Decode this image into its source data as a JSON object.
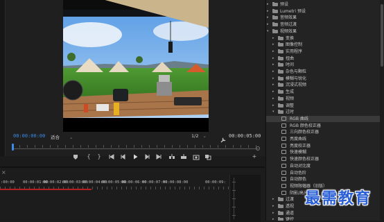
{
  "monitor": {
    "timecode_current": "00:00:00:00",
    "fit_label": "适合",
    "resolution_label": "1/2",
    "timecode_duration": "00:00:05:00"
  },
  "timeline": {
    "ruler_labels": [
      ":00:00",
      "00:00:01:00",
      "00:00:02:00",
      "00:00:03:00",
      "00:00:04:00",
      "00:00:05:00",
      "00:00:06:00",
      "00:00:07:00",
      "00:00:08:00",
      "00:00:09:"
    ]
  },
  "effects": {
    "rows": [
      {
        "label": "预设",
        "type": "folder",
        "level": 0,
        "expanded": false
      },
      {
        "label": "Lumetri 预设",
        "type": "folder",
        "level": 0,
        "expanded": false
      },
      {
        "label": "音频效果",
        "type": "folder",
        "level": 0,
        "expanded": false
      },
      {
        "label": "音频过渡",
        "type": "folder",
        "level": 0,
        "expanded": false
      },
      {
        "label": "视频效果",
        "type": "folder",
        "level": 0,
        "expanded": true
      },
      {
        "label": "变换",
        "type": "folder",
        "level": 1,
        "expanded": false
      },
      {
        "label": "图像控制",
        "type": "folder",
        "level": 1,
        "expanded": false
      },
      {
        "label": "实用程序",
        "type": "folder",
        "level": 1,
        "expanded": false
      },
      {
        "label": "扭曲",
        "type": "folder",
        "level": 1,
        "expanded": false
      },
      {
        "label": "时间",
        "type": "folder",
        "level": 1,
        "expanded": false
      },
      {
        "label": "杂色与颗粒",
        "type": "folder",
        "level": 1,
        "expanded": false
      },
      {
        "label": "模糊与锐化",
        "type": "folder",
        "level": 1,
        "expanded": false
      },
      {
        "label": "沉浸式视频",
        "type": "folder",
        "level": 1,
        "expanded": false
      },
      {
        "label": "生成",
        "type": "folder",
        "level": 1,
        "expanded": false
      },
      {
        "label": "视频",
        "type": "folder",
        "level": 1,
        "expanded": false
      },
      {
        "label": "调整",
        "type": "folder",
        "level": 1,
        "expanded": false
      },
      {
        "label": "过时",
        "type": "folder",
        "level": 1,
        "expanded": true
      },
      {
        "label": "RGB 曲线",
        "type": "effect",
        "level": 2,
        "selected": true
      },
      {
        "label": "RGB 颜色校正器",
        "type": "effect",
        "level": 2
      },
      {
        "label": "三向颜色校正器",
        "type": "effect",
        "level": 2
      },
      {
        "label": "亮度曲线",
        "type": "effect",
        "level": 2
      },
      {
        "label": "亮度校正器",
        "type": "effect",
        "level": 2
      },
      {
        "label": "快速模糊",
        "type": "effect",
        "level": 2
      },
      {
        "label": "快速颜色校正器",
        "type": "effect",
        "level": 2
      },
      {
        "label": "自动对比度",
        "type": "effect",
        "level": 2
      },
      {
        "label": "自动色阶",
        "type": "effect",
        "level": 2
      },
      {
        "label": "自动颜色",
        "type": "effect",
        "level": 2
      },
      {
        "label": "视频限幅器（旧版）",
        "type": "effect",
        "level": 2
      },
      {
        "label": "阴影/高光",
        "type": "effect",
        "level": 2
      },
      {
        "label": "过渡",
        "type": "folder",
        "level": 1,
        "expanded": false
      },
      {
        "label": "透视",
        "type": "folder",
        "level": 1,
        "expanded": false
      },
      {
        "label": "通道",
        "type": "folder",
        "level": 1,
        "expanded": false
      },
      {
        "label": "键控",
        "type": "folder",
        "level": 1,
        "expanded": false
      }
    ]
  },
  "watermark": "最需教育",
  "colors": {
    "accent": "#3b8be8",
    "playhead_red": "#b52020",
    "selected_row": "#3a3a3a"
  }
}
